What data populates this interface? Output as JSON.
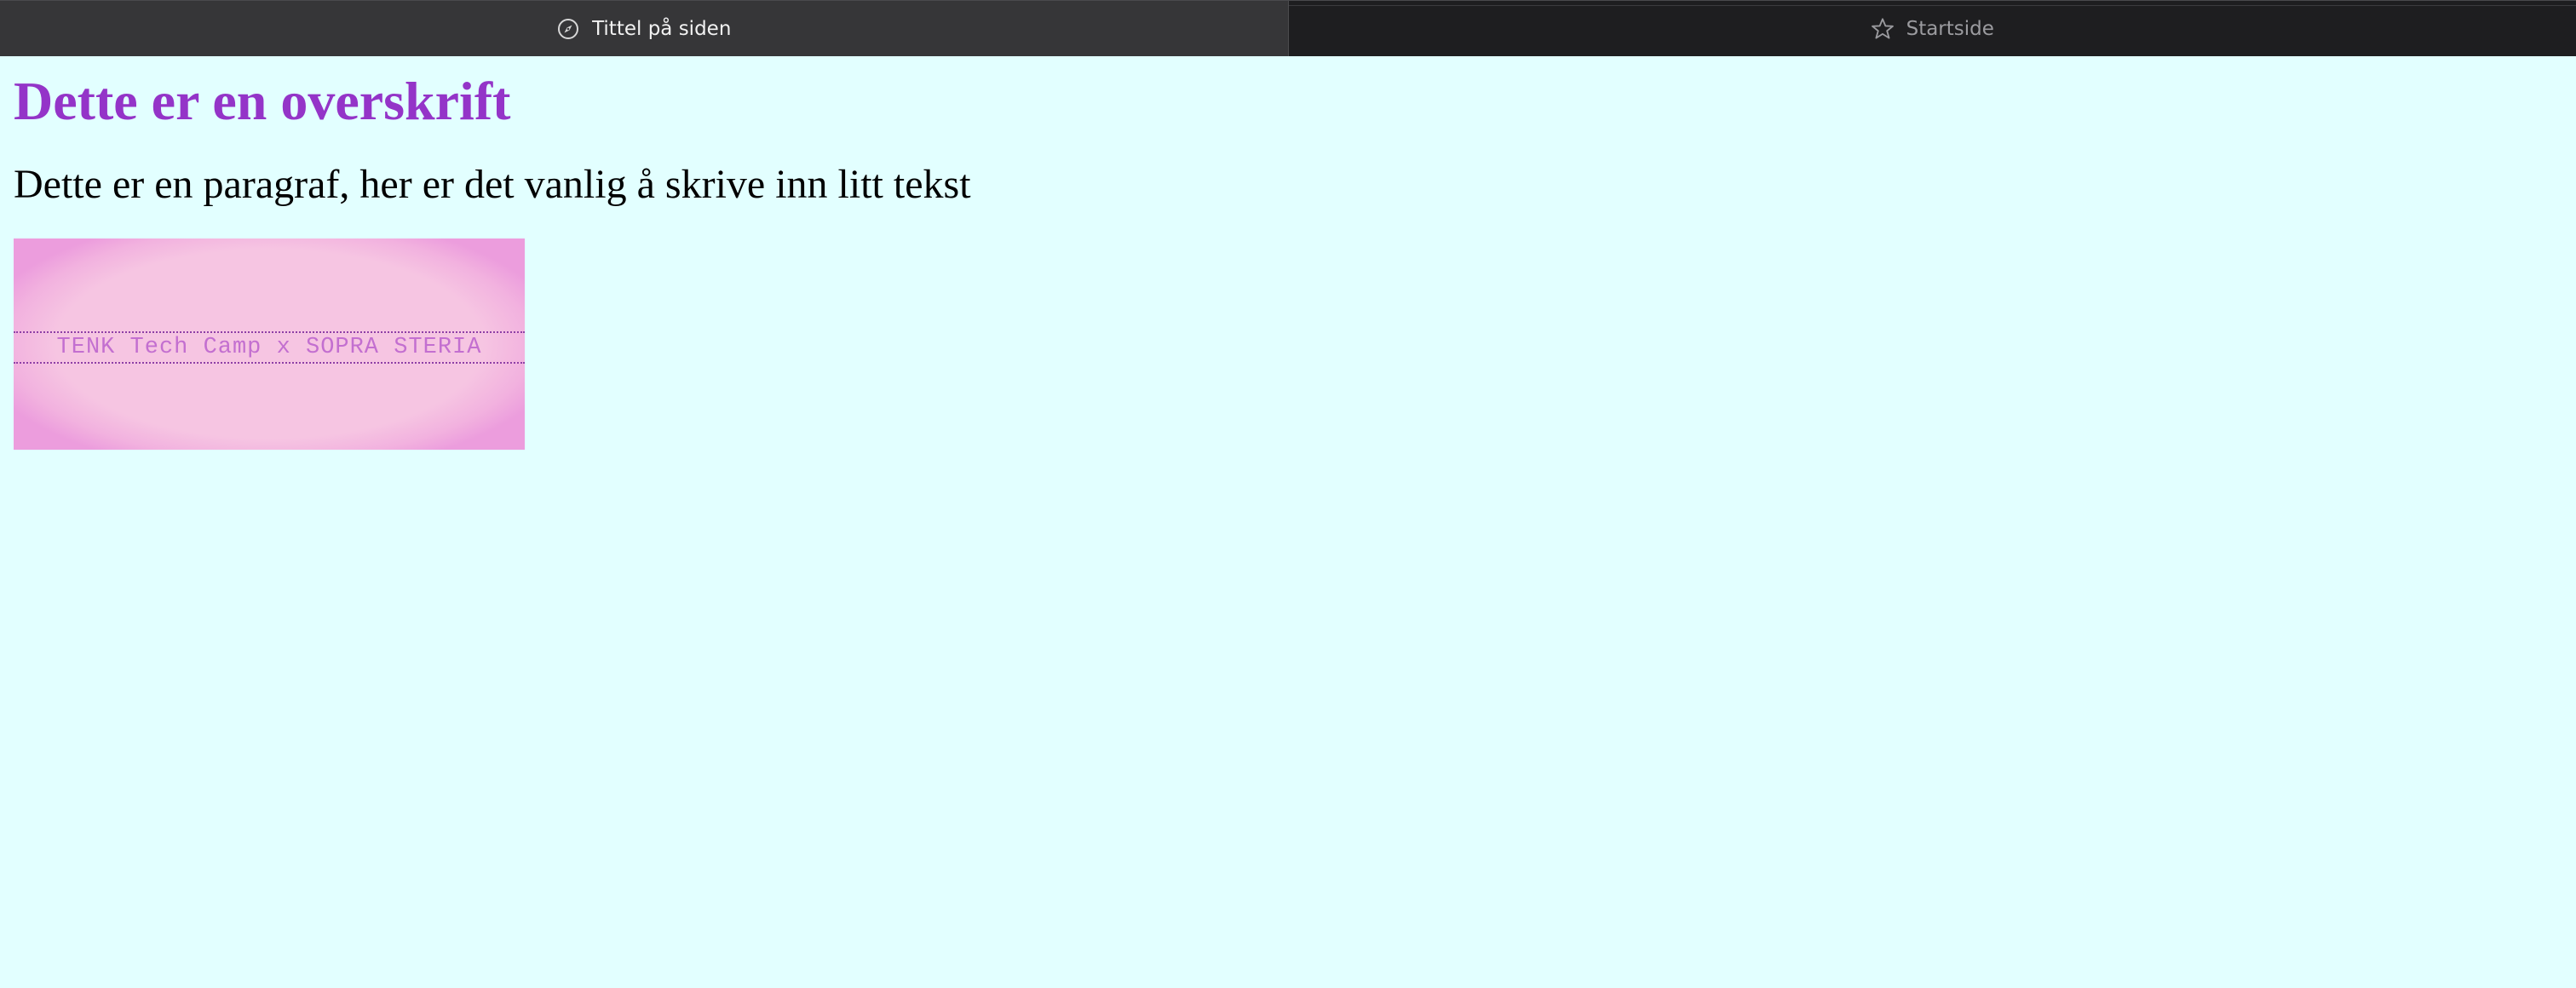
{
  "tabs": [
    {
      "label": "Tittel på siden",
      "icon": "compass-icon",
      "active": true
    },
    {
      "label": "Startside",
      "icon": "star-icon",
      "active": false
    }
  ],
  "page": {
    "heading": "Dette er en overskrift",
    "paragraph": "Dette er en paragraf, her er det vanlig å skrive inn litt tekst",
    "banner_text": "TENK Tech Camp x SOPRA STERIA"
  },
  "colors": {
    "page_background": "#e2ffff",
    "heading": "#9434c8",
    "banner_background": "#f6c5e2",
    "banner_text": "#c36fd0"
  }
}
